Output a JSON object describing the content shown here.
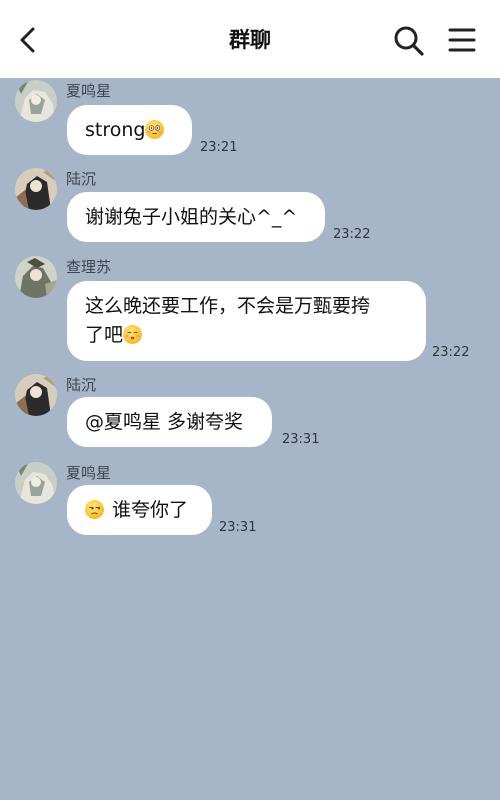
{
  "header": {
    "title": "群聊"
  },
  "messages": [
    {
      "sender": "夏鸣星",
      "text": "strong",
      "time": "23:21",
      "emoji_after": "flushed-face-emoji"
    },
    {
      "sender": "陆沉",
      "text": "谢谢兔子小姐的关心^_^",
      "time": "23:22"
    },
    {
      "sender": "查理苏",
      "text_line1": "这么晚还要工作，不会是万甄要挎",
      "text_line2": "了吧",
      "time": "23:22",
      "emoji_after": "shushing-face-emoji"
    },
    {
      "sender": "陆沉",
      "text": "@夏鸣星 多谢夸奖",
      "time": "23:31"
    },
    {
      "sender": "夏鸣星",
      "text": "谁夸你了",
      "time": "23:31",
      "emoji_before": "unamused-face-emoji"
    }
  ],
  "colors": {
    "background": "#a6b5c8",
    "bubble": "#ffffff",
    "topbar": "#ffffff"
  }
}
